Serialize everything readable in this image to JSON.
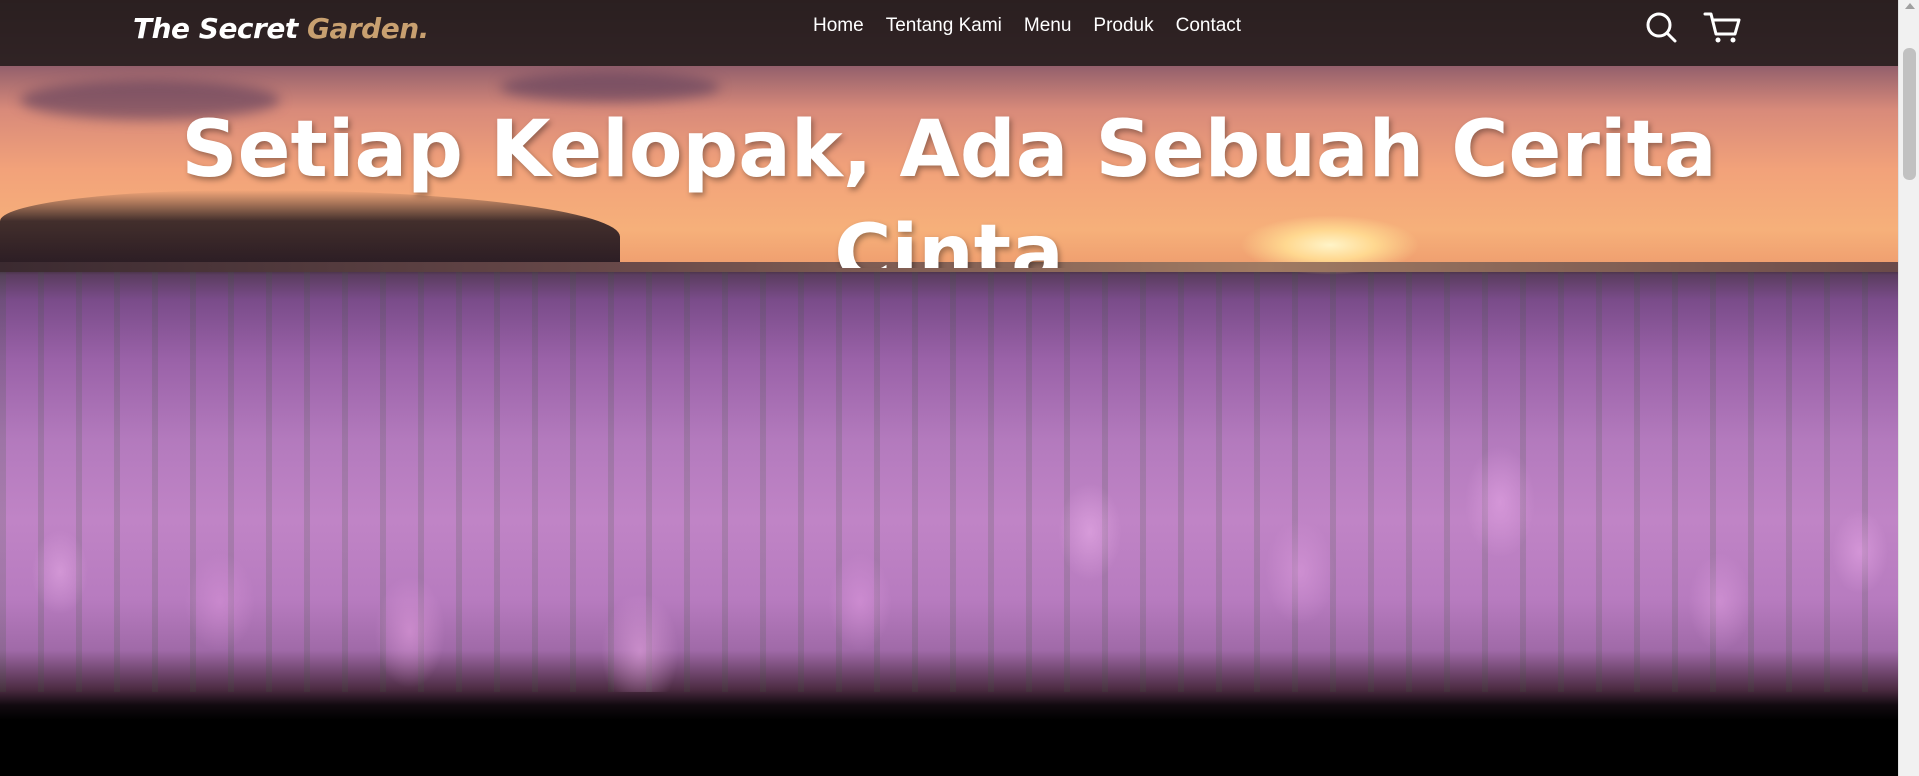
{
  "brand": {
    "name": "The Secret",
    "accent": "Garden.",
    "accent_color": "#c8a070"
  },
  "nav": {
    "items": [
      {
        "label": "Home"
      },
      {
        "label": "Tentang Kami"
      },
      {
        "label": "Menu"
      },
      {
        "label": "Produk"
      },
      {
        "label": "Contact"
      }
    ],
    "icons": [
      "search-icon",
      "cart-icon"
    ]
  },
  "hero": {
    "headline": "Setiap Kelopak, Ada Sebuah Cerita Cinta",
    "background": "tulip-field-sunset"
  },
  "colors": {
    "navbar_bg": "#281e1e",
    "text": "#ffffff"
  }
}
